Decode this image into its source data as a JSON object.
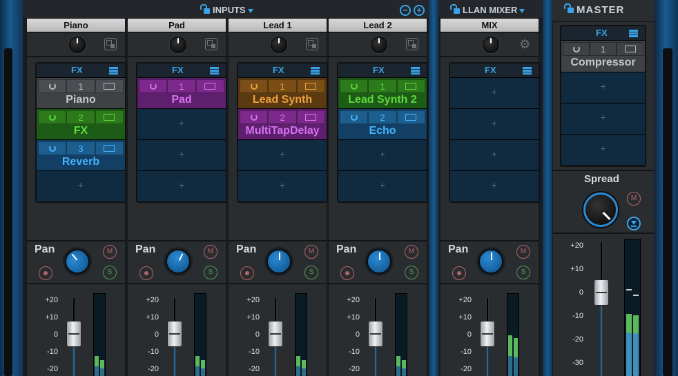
{
  "colors": {
    "accent": "#3aa3e8",
    "gray_insert": "#3e4245",
    "green_insert": "#2d7a1c",
    "blue_insert": "#1e6aa3",
    "purple_insert": "#7b2a8c",
    "orange_insert": "#8a5a1a"
  },
  "groups": {
    "inputs_title": "INPUTS",
    "llan_title": "LLAN MIXER",
    "master_title": "MASTER"
  },
  "strips": [
    {
      "name": "Piano",
      "fx_label": "FX",
      "pan_label": "Pan",
      "mute": "M",
      "solo": "S",
      "inserts": [
        {
          "num": "1",
          "name": "Piano",
          "color": "gray"
        },
        {
          "num": "2",
          "name": "FX",
          "color": "green"
        },
        {
          "num": "3",
          "name": "Reverb",
          "color": "blue"
        }
      ]
    },
    {
      "name": "Pad",
      "fx_label": "FX",
      "pan_label": "Pan",
      "mute": "M",
      "solo": "S",
      "inserts": [
        {
          "num": "1",
          "name": "Pad",
          "color": "purple"
        }
      ]
    },
    {
      "name": "Lead 1",
      "fx_label": "FX",
      "pan_label": "Pan",
      "mute": "M",
      "solo": "S",
      "inserts": [
        {
          "num": "1",
          "name": "Lead Synth",
          "color": "orange"
        },
        {
          "num": "2",
          "name": "MultiTapDelay",
          "color": "purple"
        }
      ]
    },
    {
      "name": "Lead 2",
      "fx_label": "FX",
      "pan_label": "Pan",
      "mute": "M",
      "solo": "S",
      "inserts": [
        {
          "num": "1",
          "name": "Lead Synth 2",
          "color": "green"
        },
        {
          "num": "2",
          "name": "Echo",
          "color": "blue"
        }
      ]
    },
    {
      "name": "MIX",
      "fx_label": "FX",
      "pan_label": "Pan",
      "mute": "M",
      "solo": "S",
      "inserts": []
    }
  ],
  "master": {
    "fx_label": "FX",
    "insert": {
      "num": "1",
      "name": "Compressor"
    },
    "spread_label": "Spread",
    "mute": "M",
    "scale": [
      "+20",
      "+10",
      "0",
      "-10",
      "-20",
      "-30"
    ]
  },
  "scale": [
    "+20",
    "+10",
    "0",
    "-10",
    "-20"
  ],
  "empty_slot": "+"
}
